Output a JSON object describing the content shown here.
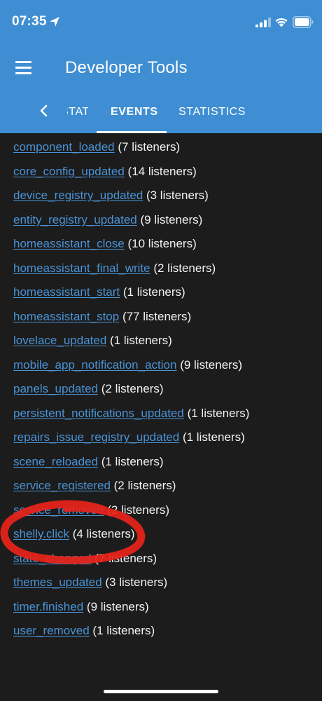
{
  "status_bar": {
    "time": "07:35"
  },
  "toolbar": {
    "title": "Developer Tools"
  },
  "tabs": {
    "state_label": "STATE",
    "events_label": "EVENTS",
    "statistics_label": "STATISTICS"
  },
  "events": [
    {
      "name": "component_loaded",
      "count": "(7 listeners)"
    },
    {
      "name": "core_config_updated",
      "count": "(14 listeners)"
    },
    {
      "name": "device_registry_updated",
      "count": "(3 listeners)"
    },
    {
      "name": "entity_registry_updated",
      "count": "(9 listeners)"
    },
    {
      "name": "homeassistant_close",
      "count": "(10 listeners)"
    },
    {
      "name": "homeassistant_final_write",
      "count": "(2 listeners)"
    },
    {
      "name": "homeassistant_start",
      "count": "(1 listeners)"
    },
    {
      "name": "homeassistant_stop",
      "count": "(77 listeners)"
    },
    {
      "name": "lovelace_updated",
      "count": "(1 listeners)"
    },
    {
      "name": "mobile_app_notification_action",
      "count": "(9 listeners)"
    },
    {
      "name": "panels_updated",
      "count": "(2 listeners)"
    },
    {
      "name": "persistent_notifications_updated",
      "count": "(1 listeners)"
    },
    {
      "name": "repairs_issue_registry_updated",
      "count": "(1 listeners)"
    },
    {
      "name": "scene_reloaded",
      "count": "(1 listeners)"
    },
    {
      "name": "service_registered",
      "count": "(2 listeners)"
    },
    {
      "name": "service_removed",
      "count": "(2 listeners)"
    },
    {
      "name": "shelly.click",
      "count": "(4 listeners)"
    },
    {
      "name": "state_changed",
      "count": "(7 listeners)"
    },
    {
      "name": "themes_updated",
      "count": "(3 listeners)"
    },
    {
      "name": "timer.finished",
      "count": "(9 listeners)"
    },
    {
      "name": "user_removed",
      "count": "(1 listeners)"
    }
  ],
  "colors": {
    "header": "#3f8ed3",
    "background": "#1c1c1c",
    "link": "#4a93d6",
    "annotation": "#e8231a"
  },
  "icons": {
    "location": "location-arrow-icon",
    "signal": "cellular-signal-icon",
    "wifi": "wifi-icon",
    "battery": "battery-icon",
    "menu": "hamburger-menu-icon",
    "back": "chevron-left-icon"
  }
}
